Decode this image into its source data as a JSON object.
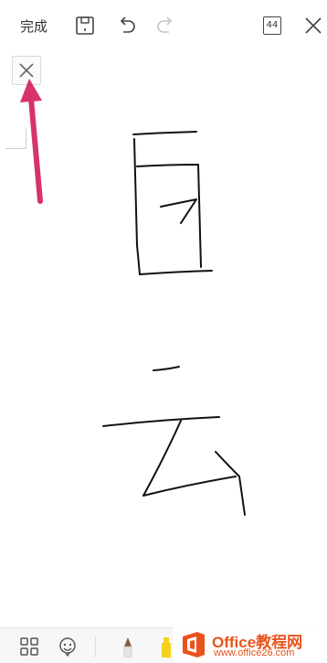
{
  "toolbar": {
    "done_label": "完成",
    "page_count": "44",
    "icons": [
      "save-icon",
      "undo-icon",
      "redo-icon",
      "page-count-icon",
      "close-icon"
    ]
  },
  "canvas": {
    "close_button_icon": "close-icon",
    "annotation_arrow_color": "#d6336c",
    "ink_color": "#111111"
  },
  "bottom_bar": {
    "icons": [
      "templates-icon",
      "sticker-icon",
      "pen-brown-icon",
      "highlighter-yellow-icon",
      "menu-icon"
    ]
  },
  "watermark": {
    "title": "Office教程网",
    "url": "www.office26.com"
  }
}
